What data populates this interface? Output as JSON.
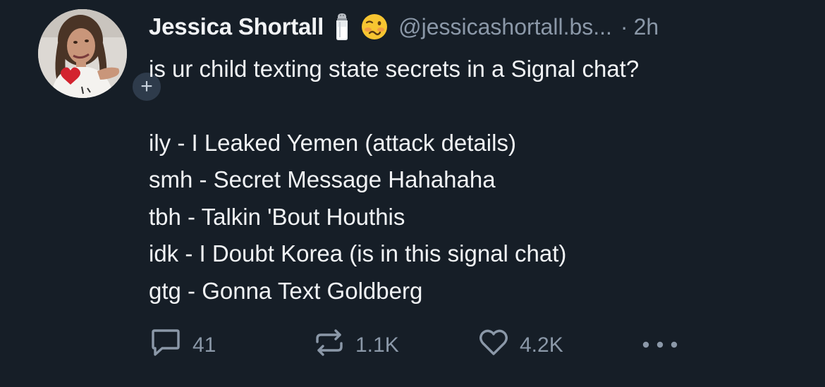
{
  "author": {
    "display_name": "Jessica Shortall",
    "name_emojis": [
      "salt-shaker-icon",
      "woozy-face-icon"
    ],
    "handle": "@jessicashortall.bs...",
    "separator": "·",
    "timestamp": "2h",
    "follow_glyph": "+"
  },
  "post": {
    "lines": [
      "is ur child texting state secrets in a Signal chat?",
      "",
      "ily - I Leaked Yemen (attack details)",
      "smh - Secret Message Hahahaha",
      "tbh - Talkin 'Bout Houthis",
      "idk - I Doubt Korea (is in this signal chat)",
      "gtg - Gonna Text Goldberg"
    ]
  },
  "actions": {
    "replies": "41",
    "reposts": "1.1K",
    "likes": "4.2K"
  },
  "colors": {
    "background": "#161e27",
    "text": "#f1f3f5",
    "muted": "#8b98a8",
    "badge": "#2e3b4b"
  }
}
